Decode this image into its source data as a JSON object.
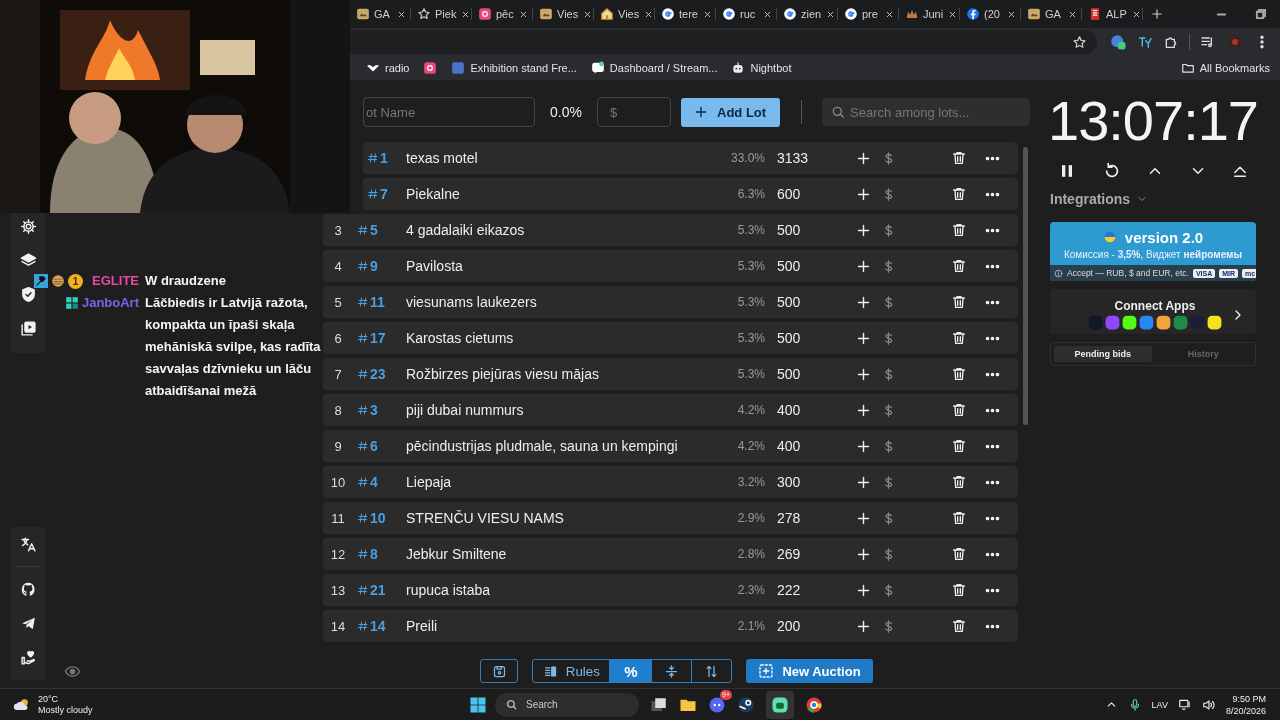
{
  "browser": {
    "tabs": [
      {
        "kind": "generic",
        "title": "GA"
      },
      {
        "kind": "star",
        "title": "Piek"
      },
      {
        "kind": "pink",
        "title": "pēc"
      },
      {
        "kind": "generic",
        "title": "Vies"
      },
      {
        "kind": "home",
        "title": "Vies"
      },
      {
        "kind": "google",
        "title": "tere"
      },
      {
        "kind": "google",
        "title": "ruc"
      },
      {
        "kind": "google",
        "title": "zien"
      },
      {
        "kind": "google",
        "title": "pre"
      },
      {
        "kind": "crown",
        "title": "Juni"
      },
      {
        "kind": "facebook",
        "title": "(20"
      },
      {
        "kind": "generic",
        "title": "GA"
      },
      {
        "kind": "flag",
        "title": "ALP"
      }
    ],
    "bookmarks": [
      {
        "kind": "bird",
        "label": "radio"
      },
      {
        "kind": "pink"
      },
      {
        "kind": "square",
        "label": "Exhibition stand Fre..."
      },
      {
        "kind": "chat",
        "label": "Dashboard / Stream..."
      },
      {
        "kind": "robot",
        "label": "Nightbot"
      }
    ],
    "all_bookmarks": "All Bookmarks"
  },
  "chat": [
    {
      "user": "EGLITE",
      "color": "#e24aa6",
      "badges": [
        {
          "kind": "hammer"
        },
        {
          "kind": "cookie"
        },
        {
          "kind": "coin",
          "text": "1"
        }
      ],
      "text": "W draudzene"
    },
    {
      "user": "JanboArt",
      "color": "#7368e8",
      "badges": [
        {
          "kind": "pixel"
        }
      ],
      "text": "Lāčbiedis ir Latvijā ražota, kompakta un īpaši skaļa mehāniskā svilpe, kas radīta savvaļas dzīvnieku un lāču atbaidīšanai mežā"
    }
  ],
  "toolbar": {
    "lot_name_placeholder": "ot Name",
    "percent": "0.0%",
    "amount_placeholder": "$",
    "add_button": "Add Lot",
    "search_placeholder": "Search among lots..."
  },
  "lots": [
    {
      "id": "1",
      "name": "texas motel",
      "share": "33.0%",
      "amount": "3133"
    },
    {
      "id": "7",
      "name": "Piekalne",
      "share": "6.3%",
      "amount": "600"
    },
    {
      "rank": "3",
      "id": "5",
      "name": "4 gadalaiki eikazos",
      "share": "5.3%",
      "amount": "500"
    },
    {
      "rank": "4",
      "id": "9",
      "name": "Pavilosta",
      "share": "5.3%",
      "amount": "500"
    },
    {
      "rank": "5",
      "id": "11",
      "name": "viesunams laukezers",
      "share": "5.3%",
      "amount": "500"
    },
    {
      "rank": "6",
      "id": "17",
      "name": "Karostas cietums",
      "share": "5.3%",
      "amount": "500"
    },
    {
      "rank": "7",
      "id": "23",
      "name": "Rožbirzes piejūras viesu mājas",
      "share": "5.3%",
      "amount": "500"
    },
    {
      "rank": "8",
      "id": "3",
      "name": "piji dubai nummurs",
      "share": "4.2%",
      "amount": "400"
    },
    {
      "rank": "9",
      "id": "6",
      "name": "pēcindustrijas pludmale, sauna un kempingi",
      "share": "4.2%",
      "amount": "400"
    },
    {
      "rank": "10",
      "id": "4",
      "name": "Liepaja",
      "share": "3.2%",
      "amount": "300"
    },
    {
      "rank": "11",
      "id": "10",
      "name": "STRENČU VIESU NAMS",
      "share": "2.9%",
      "amount": "278"
    },
    {
      "rank": "12",
      "id": "8",
      "name": "Jebkur Smiltene",
      "share": "2.8%",
      "amount": "269"
    },
    {
      "rank": "13",
      "id": "21",
      "name": "rupuca istaba",
      "share": "2.3%",
      "amount": "222"
    },
    {
      "rank": "14",
      "id": "14",
      "name": "Preili",
      "share": "2.1%",
      "amount": "200"
    }
  ],
  "bottom_toolbar": {
    "rules": "Rules",
    "modes": [
      {
        "kind": "percent",
        "label": "%",
        "selected": true
      },
      {
        "kind": "compress",
        "selected": false
      },
      {
        "kind": "sort",
        "selected": false
      }
    ],
    "new_auction": "New Auction"
  },
  "timer": "13:07:17",
  "integrations": "Integrations",
  "promo": {
    "title": "version 2.0",
    "subtitle": "Комиссия - **3,5%**, Виджет **нейромемы**",
    "accept": "Accept — RUB, $ and EUR, etc.",
    "payment_marks": [
      "VISA",
      "MIR",
      "mc"
    ]
  },
  "connect_apps": {
    "title": "Connect Apps",
    "apps": [
      {
        "color": "#111827"
      },
      {
        "color": "#9146ff"
      },
      {
        "color": "#53fc18"
      },
      {
        "color": "#2787f5"
      },
      {
        "color": "#f2a33a"
      },
      {
        "color": "#1f8a4c"
      },
      {
        "color": "#1d1d3a"
      },
      {
        "color": "#f5e21b"
      }
    ]
  },
  "bid_tabs": [
    {
      "label": "Pending bids",
      "selected": true
    },
    {
      "label": "History",
      "selected": false
    }
  ],
  "taskbar": {
    "temperature": "20°C",
    "weather": "Mostly cloudy",
    "search": "Search",
    "discord_badge": "9+",
    "language": "LAV",
    "time": "9:50 PM",
    "date": "8/20/2026"
  }
}
